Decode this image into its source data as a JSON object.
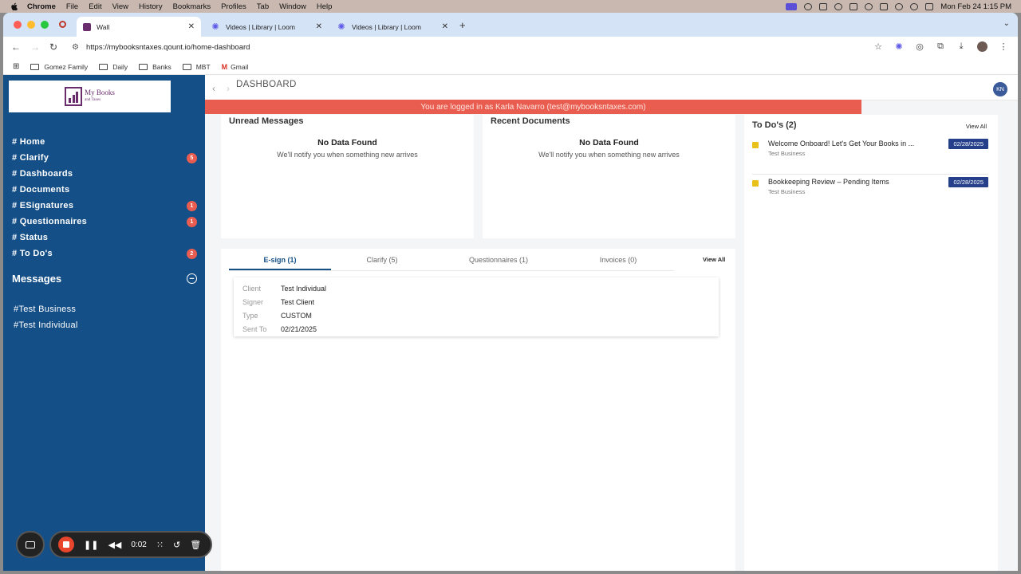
{
  "menubar": {
    "items": [
      "Chrome",
      "File",
      "Edit",
      "View",
      "History",
      "Bookmarks",
      "Profiles",
      "Tab",
      "Window",
      "Help"
    ],
    "clock": "Mon Feb 24  1:15 PM"
  },
  "browser": {
    "tabs": [
      {
        "title": "Wall"
      },
      {
        "title": "Videos | Library | Loom"
      },
      {
        "title": "Videos | Library | Loom"
      }
    ],
    "url": "https://mybooksntaxes.qount.io/home-dashboard",
    "bookmarks": [
      "Gomez Family",
      "Daily",
      "Banks",
      "MBT",
      "Gmail"
    ]
  },
  "logo": {
    "line1": "My Books",
    "line2": "and Taxes"
  },
  "sidebar": {
    "nav": [
      {
        "label": "# Home",
        "badge": ""
      },
      {
        "label": "# Clarify",
        "badge": "5"
      },
      {
        "label": "# Dashboards",
        "badge": ""
      },
      {
        "label": "# Documents",
        "badge": ""
      },
      {
        "label": "# ESignatures",
        "badge": "1"
      },
      {
        "label": "# Questionnaires",
        "badge": "1"
      },
      {
        "label": "# Status",
        "badge": ""
      },
      {
        "label": "# To Do's",
        "badge": "2"
      }
    ],
    "messages_heading": "Messages",
    "messages": [
      "#Test Business",
      "#Test Individual"
    ]
  },
  "header": {
    "title": "DASHBOARD",
    "user_initials": "KN"
  },
  "banner": "You are logged in as Karla Navarro (test@mybooksntaxes.com)",
  "unread": {
    "title": "Unread Messages",
    "empty_title": "No Data Found",
    "empty_sub": "We'll notify you when something new arrives"
  },
  "recent": {
    "title": "Recent Documents",
    "empty_title": "No Data Found",
    "empty_sub": "We'll notify you when something new arrives"
  },
  "doc_tabs": {
    "tabs": [
      "E-sign (1)",
      "Clarify (5)",
      "Questionnaires (1)",
      "Invoices (0)"
    ],
    "view_all": "View All"
  },
  "esign": {
    "rows": [
      {
        "key": "Client",
        "value": "Test Individual"
      },
      {
        "key": "Signer",
        "value": "Test Client"
      },
      {
        "key": "Type",
        "value": "CUSTOM"
      },
      {
        "key": "Sent To",
        "value": "02/21/2025"
      }
    ]
  },
  "todos": {
    "title": "To Do's (2)",
    "view_all": "View All",
    "items": [
      {
        "title": "Welcome Onboard! Let's Get Your Books in ...",
        "sub": "Test Business",
        "date": "02/28/2025"
      },
      {
        "title": "Bookkeeping Review – Pending Items",
        "sub": "Test Business",
        "date": "02/28/2025"
      }
    ]
  },
  "loom": {
    "time": "0:02"
  },
  "colors": {
    "sidebar": "#154f87",
    "banner": "#e85d4f",
    "date_badge": "#253f8a",
    "todo_dot": "#e8c21a"
  }
}
